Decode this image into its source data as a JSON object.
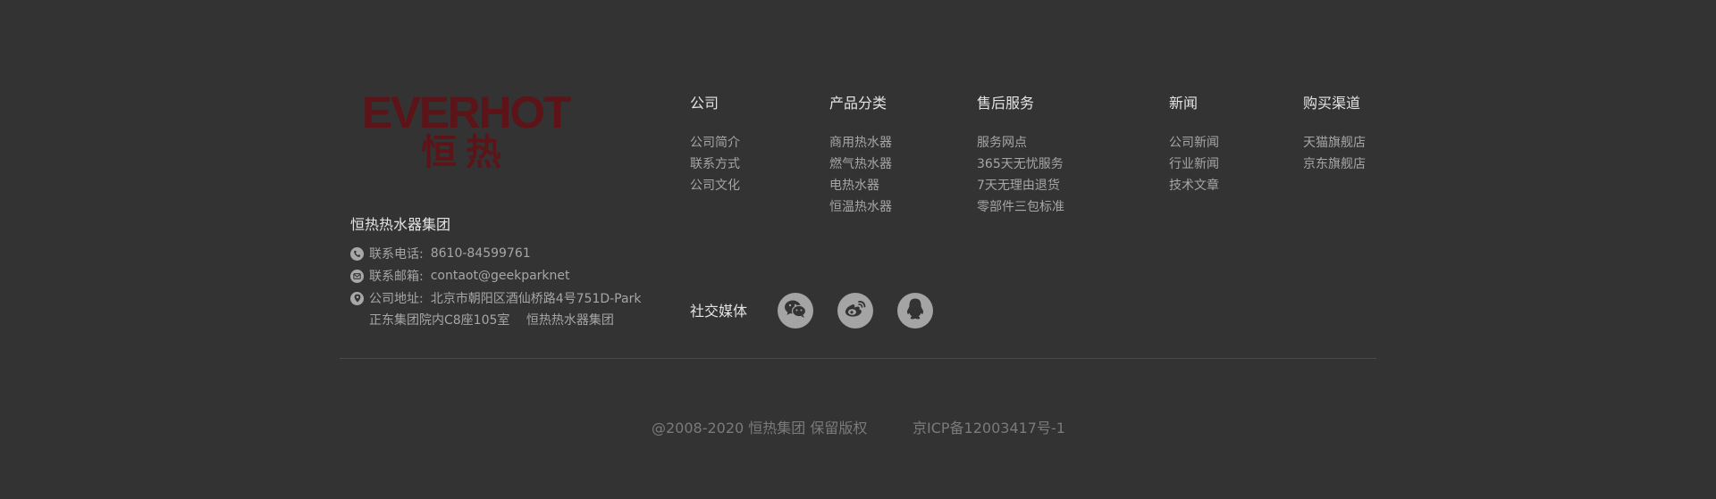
{
  "brand": {
    "logo_en": "EVERHOT",
    "logo_cn": "恒热",
    "logo_color": "#5c1418",
    "company_name": "恒热热水器集团"
  },
  "contact": {
    "phone_label": "联系电话:",
    "phone_value": "8610-84599761",
    "email_label": "联系邮箱:",
    "email_value": "contaot@geekparknet",
    "address_label": "公司地址:",
    "address_line1": "北京市朝阳区酒仙桥路4号751D-Park",
    "address_line2a": "正东集团院内C8座105室",
    "address_line2b": "恒热热水器集团"
  },
  "nav": {
    "company": {
      "title": "公司",
      "items": [
        "公司简介",
        "联系方式",
        "公司文化"
      ]
    },
    "products": {
      "title": "产品分类",
      "items": [
        "商用热水器",
        "燃气热水器",
        "电热水器",
        "恒温热水器"
      ]
    },
    "service": {
      "title": "售后服务",
      "items": [
        "服务网点",
        "365天无忧服务",
        "7天无理由退货",
        "零部件三包标准"
      ]
    },
    "news": {
      "title": "新闻",
      "items": [
        "公司新闻",
        "行业新闻",
        "技术文章"
      ]
    },
    "channels": {
      "title": "购买渠道",
      "items": [
        "天猫旗舰店",
        "京东旗舰店"
      ]
    }
  },
  "social": {
    "label": "社交媒体",
    "icons": [
      "wechat-icon",
      "weibo-icon",
      "qq-icon"
    ]
  },
  "bottom": {
    "copyright": "@2008-2020 恒热集团  保留版权",
    "icp": "京ICP备12003417号-1"
  },
  "colors": {
    "background": "#333333",
    "title_text": "#e4e4e4",
    "body_text": "#a6a6a6",
    "muted_text": "#7a7a7a",
    "icon_bg": "#a4a4a4"
  }
}
